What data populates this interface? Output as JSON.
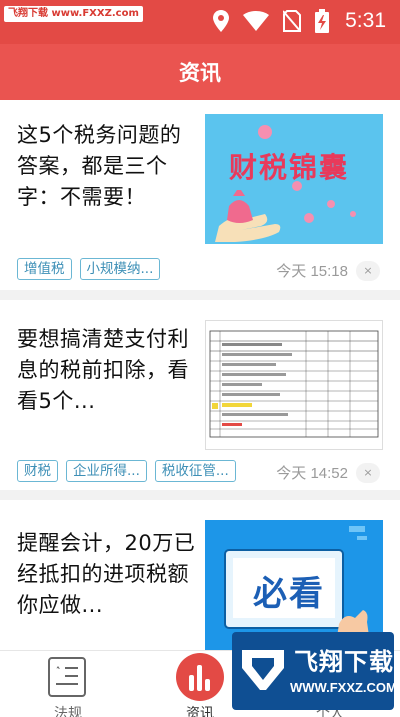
{
  "status_bar": {
    "watermark": "飞翔下载 www.FXXZ.com",
    "time": "5:31"
  },
  "header": {
    "title": "资讯"
  },
  "feed": [
    {
      "title": "这5个税务问题的答案，都是三个字：不需要！",
      "thumb_caption": "财税锦囊",
      "tags": [
        "增值税",
        "小规模纳..."
      ],
      "time": "今天 15:18",
      "close": "×"
    },
    {
      "title": "要想搞清楚支付利息的税前扣除，看看5个...",
      "thumb_caption": "",
      "tags": [
        "财税",
        "企业所得...",
        "税收征管..."
      ],
      "time": "今天 14:52",
      "close": "×"
    },
    {
      "title": "提醒会计，20万已经抵扣的进项税额你应做...",
      "thumb_caption": "必看",
      "tags": [],
      "time": "",
      "close": ""
    }
  ],
  "bottom_nav": {
    "items": [
      {
        "label": "法规",
        "icon": "document-icon"
      },
      {
        "label": "资讯",
        "icon": "chart-icon",
        "active": true
      },
      {
        "label": "个人",
        "icon": "person-icon"
      }
    ]
  },
  "watermark_br": {
    "big": "飞翔下载",
    "small": "WWW.FXXZ.COM"
  },
  "colors": {
    "brand": "#ea5450",
    "tag_border": "#6bb7d4",
    "tag_text": "#3d8fb6"
  }
}
